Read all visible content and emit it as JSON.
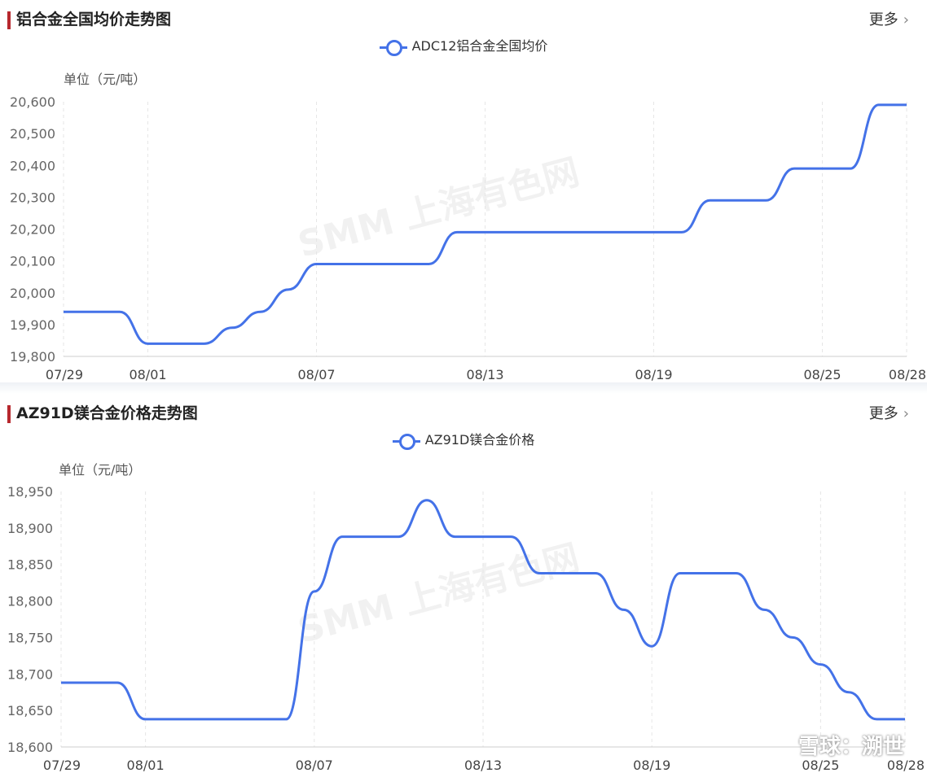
{
  "panels": [
    {
      "title": "铝合金全国均价走势图",
      "more_label": "更多",
      "legend_label": "ADC12铝合金全国均价",
      "unit_label": "单位（元/吨）",
      "watermark": "SMM 上海有色网"
    },
    {
      "title": "AZ91D镁合金价格走势图",
      "more_label": "更多",
      "legend_label": "AZ91D镁合金价格",
      "unit_label": "单位（元/吨）",
      "watermark": "SMM 上海有色网"
    }
  ],
  "corner_watermark": "雪球：溯世",
  "colors": {
    "series": "#4472e8",
    "title_bar": "#b7282e",
    "axis": "#cccccc",
    "grid": "#e6e6e6"
  },
  "chart_data": [
    {
      "type": "line",
      "title": "铝合金全国均价走势图",
      "ylabel": "单位（元/吨）",
      "ylim": [
        19800,
        20600
      ],
      "yticks": [
        19800,
        19900,
        20000,
        20100,
        20200,
        20300,
        20400,
        20500,
        20600
      ],
      "xlim": [
        "07/29",
        "08/28"
      ],
      "xticks": [
        "07/29",
        "08/01",
        "08/07",
        "08/13",
        "08/19",
        "08/25",
        "08/28"
      ],
      "grid": "vertical dashed",
      "legend": "top-center",
      "series": [
        {
          "name": "ADC12铝合金全国均价",
          "x": [
            "07/29",
            "07/30",
            "07/31",
            "08/01",
            "08/02",
            "08/03",
            "08/04",
            "08/05",
            "08/06",
            "08/07",
            "08/08",
            "08/09",
            "08/10",
            "08/11",
            "08/12",
            "08/13",
            "08/14",
            "08/15",
            "08/16",
            "08/17",
            "08/18",
            "08/19",
            "08/20",
            "08/21",
            "08/22",
            "08/23",
            "08/24",
            "08/25",
            "08/26",
            "08/27",
            "08/28"
          ],
          "values": [
            19940,
            19940,
            19940,
            19840,
            19840,
            19840,
            19890,
            19940,
            20010,
            20090,
            20090,
            20090,
            20090,
            20090,
            20190,
            20190,
            20190,
            20190,
            20190,
            20190,
            20190,
            20190,
            20190,
            20290,
            20290,
            20290,
            20390,
            20390,
            20390,
            20590,
            20590
          ]
        }
      ]
    },
    {
      "type": "line",
      "title": "AZ91D镁合金价格走势图",
      "ylabel": "单位（元/吨）",
      "ylim": [
        18600,
        18950
      ],
      "yticks": [
        18600,
        18650,
        18700,
        18750,
        18800,
        18850,
        18900,
        18950
      ],
      "xlim": [
        "07/29",
        "08/28"
      ],
      "xticks": [
        "07/29",
        "08/01",
        "08/07",
        "08/13",
        "08/19",
        "08/25",
        "08/28"
      ],
      "grid": "vertical dashed",
      "legend": "top-center",
      "series": [
        {
          "name": "AZ91D镁合金价格",
          "x": [
            "07/29",
            "07/30",
            "07/31",
            "08/01",
            "08/02",
            "08/03",
            "08/04",
            "08/05",
            "08/06",
            "08/07",
            "08/08",
            "08/09",
            "08/10",
            "08/11",
            "08/12",
            "08/13",
            "08/14",
            "08/15",
            "08/16",
            "08/17",
            "08/18",
            "08/19",
            "08/20",
            "08/21",
            "08/22",
            "08/23",
            "08/24",
            "08/25",
            "08/26",
            "08/27",
            "08/28"
          ],
          "values": [
            18688,
            18688,
            18688,
            18638,
            18638,
            18638,
            18638,
            18638,
            18638,
            18813,
            18888,
            18888,
            18888,
            18938,
            18888,
            18888,
            18888,
            18838,
            18838,
            18838,
            18788,
            18738,
            18838,
            18838,
            18838,
            18788,
            18750,
            18713,
            18675,
            18638,
            18638
          ]
        }
      ]
    }
  ]
}
